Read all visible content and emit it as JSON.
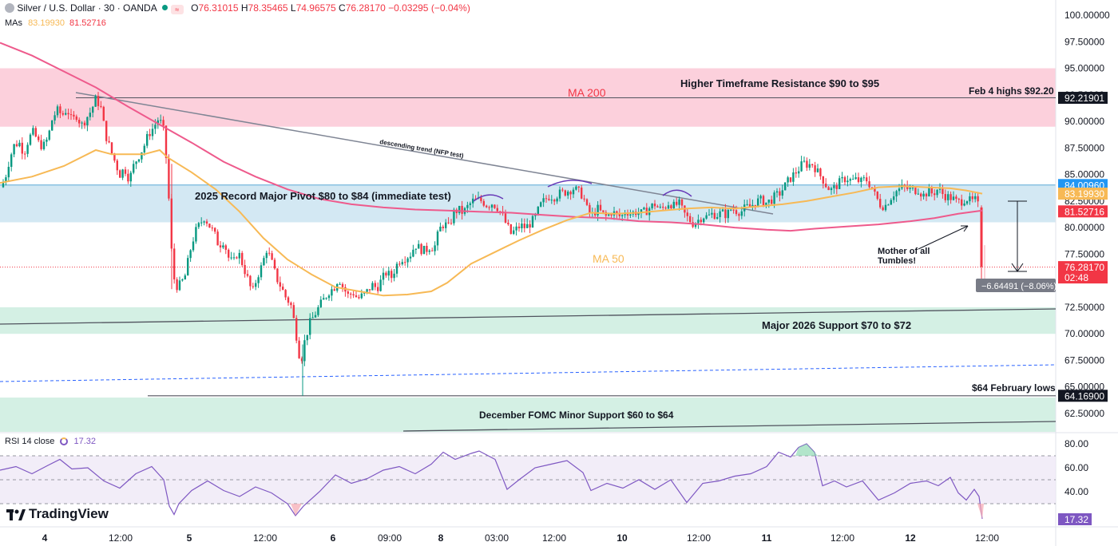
{
  "header": {
    "symbol": "Silver / U.S. Dollar · 30 · OANDA",
    "ohlc": {
      "o_label": "O",
      "o": "76.31015",
      "h_label": "H",
      "h": "78.35465",
      "l_label": "L",
      "l": "74.96575",
      "c_label": "C",
      "c": "76.28170",
      "change": "−0.03295 (−0.04%)"
    },
    "mas_label": "MAs",
    "ma50_value": "83.19930",
    "ma200_value": "81.52716",
    "rsi_label": "RSI 14 close",
    "rsi_value": "17.32"
  },
  "branding": {
    "logo_text": "TradingView"
  },
  "colors": {
    "bull": "#089981",
    "bear": "#f23645",
    "ma50": "#f7b955",
    "ma200": "#ee5a8c",
    "rsi": "#7e57c2",
    "axis_text": "#131722"
  },
  "chart_data": {
    "type": "candlestick",
    "symbol": "Silver / U.S. Dollar",
    "timeframe": "30",
    "price_axis": {
      "ticks": [
        "100.00000",
        "97.50000",
        "95.00000",
        "92.50000",
        "90.00000",
        "87.50000",
        "85.00000",
        "82.50000",
        "80.00000",
        "77.50000",
        "72.50000",
        "70.00000",
        "67.50000",
        "65.00000",
        "62.50000"
      ],
      "ylim": [
        60.2,
        100.8
      ]
    },
    "time_axis": {
      "labels": [
        "4",
        "12:00",
        "5",
        "12:00",
        "6",
        "09:00",
        "8",
        "03:00",
        "12:00",
        "10",
        "12:00",
        "11",
        "12:00",
        "12",
        "12:00"
      ],
      "bold_labels": [
        "4",
        "5",
        "6",
        "8",
        "10",
        "11",
        "12"
      ]
    },
    "price_labels": [
      {
        "text": "92.21901",
        "price": 92.219,
        "color": "#131722"
      },
      {
        "text": "84.00960",
        "price": 84.0096,
        "color": "#2196f3"
      },
      {
        "text": "83.19930",
        "price": 83.1993,
        "color": "#f7b955"
      },
      {
        "text": "81.52716",
        "price": 81.52716,
        "color": "#f23645"
      },
      {
        "text": "76.28170",
        "price": 76.2817,
        "color": "#f23645",
        "sub": "02:48"
      },
      {
        "text": "64.16900",
        "price": 64.169,
        "color": "#131722"
      }
    ],
    "zones": [
      {
        "label": "Higher Timeframe Resistance $90 to $95",
        "from": 89.5,
        "to": 95.0,
        "color": "#fcd0dc"
      },
      {
        "label": "2025 Record Major Pivot $80 to $84 (immediate test)",
        "from": 80.5,
        "to": 84.0,
        "color": "#d3e8f3"
      },
      {
        "label": "Major 2026 Support $70 to $72",
        "from": 70.0,
        "to": 72.5,
        "color": "#d4f0e4"
      },
      {
        "label": "December FOMC Minor Support $60 to $64",
        "from": 60.3,
        "to": 64.0,
        "color": "#d4f0e4"
      }
    ],
    "annotations": [
      {
        "text": "MA 200",
        "color": "#f23645"
      },
      {
        "text": "MA 50",
        "color": "#f7b955"
      },
      {
        "text": "Feb 4 highs $92.20"
      },
      {
        "text": "descending trend (NFP test)"
      },
      {
        "text": "$64 February lows"
      },
      {
        "text": "Mother of all"
      },
      {
        "text": "Tumbles!"
      },
      {
        "text": "−6.64491 (−8.06%)"
      }
    ],
    "close_points": [
      [
        0,
        83.8
      ],
      [
        6,
        84.5
      ],
      [
        12,
        86.5
      ],
      [
        18,
        87.8
      ],
      [
        24,
        88.0
      ],
      [
        30,
        87.0
      ],
      [
        36,
        88.4
      ],
      [
        42,
        89.0
      ],
      [
        48,
        88.0
      ],
      [
        54,
        87.6
      ],
      [
        60,
        88.4
      ],
      [
        66,
        90.4
      ],
      [
        72,
        91.0
      ],
      [
        78,
        90.6
      ],
      [
        84,
        91.2
      ],
      [
        90,
        90.0
      ],
      [
        96,
        90.6
      ],
      [
        102,
        89.6
      ],
      [
        108,
        90.3
      ],
      [
        114,
        91.0
      ],
      [
        120,
        92.1
      ],
      [
        126,
        91.4
      ],
      [
        132,
        88.8
      ],
      [
        138,
        87.4
      ],
      [
        144,
        86.2
      ],
      [
        150,
        85.0
      ],
      [
        156,
        85.6
      ],
      [
        162,
        84.5
      ],
      [
        168,
        86.0
      ],
      [
        174,
        86.8
      ],
      [
        180,
        87.6
      ],
      [
        186,
        88.8
      ],
      [
        192,
        89.4
      ],
      [
        198,
        90.2
      ],
      [
        204,
        89.6
      ],
      [
        208,
        86.6
      ],
      [
        212,
        82.0
      ],
      [
        216,
        76.0
      ],
      [
        220,
        74.5
      ],
      [
        226,
        74.6
      ],
      [
        232,
        75.5
      ],
      [
        238,
        77.8
      ],
      [
        244,
        79.5
      ],
      [
        250,
        80.3
      ],
      [
        256,
        81.0
      ],
      [
        262,
        80.2
      ],
      [
        268,
        79.5
      ],
      [
        274,
        78.3
      ],
      [
        280,
        78.8
      ],
      [
        286,
        77.2
      ],
      [
        292,
        76.6
      ],
      [
        298,
        77.8
      ],
      [
        304,
        76.5
      ],
      [
        310,
        75.2
      ],
      [
        316,
        73.8
      ],
      [
        322,
        75.4
      ],
      [
        328,
        76.4
      ],
      [
        334,
        78.0
      ],
      [
        340,
        76.8
      ],
      [
        346,
        75.3
      ],
      [
        352,
        74.4
      ],
      [
        358,
        73.4
      ],
      [
        364,
        72.8
      ],
      [
        370,
        70.5
      ],
      [
        374,
        68.2
      ],
      [
        378,
        67.8
      ],
      [
        382,
        69.5
      ],
      [
        388,
        71.0
      ],
      [
        394,
        71.8
      ],
      [
        400,
        72.6
      ],
      [
        406,
        73.3
      ],
      [
        412,
        74.0
      ],
      [
        418,
        74.3
      ],
      [
        424,
        75.3
      ],
      [
        430,
        74.3
      ],
      [
        436,
        73.6
      ],
      [
        442,
        73.9
      ],
      [
        448,
        73.3
      ],
      [
        454,
        73.6
      ],
      [
        460,
        74.0
      ],
      [
        466,
        74.6
      ],
      [
        472,
        74.3
      ],
      [
        478,
        75.1
      ],
      [
        484,
        75.8
      ],
      [
        490,
        75.3
      ],
      [
        496,
        76.4
      ],
      [
        502,
        77.1
      ],
      [
        508,
        77.2
      ],
      [
        514,
        77.5
      ],
      [
        520,
        78.4
      ],
      [
        526,
        78.0
      ],
      [
        532,
        77.8
      ],
      [
        538,
        78.2
      ],
      [
        544,
        78.1
      ],
      [
        550,
        79.8
      ],
      [
        556,
        80.4
      ],
      [
        562,
        80.0
      ],
      [
        568,
        81.4
      ],
      [
        574,
        81.7
      ],
      [
        580,
        81.4
      ],
      [
        586,
        82.0
      ],
      [
        592,
        82.5
      ],
      [
        598,
        82.6
      ],
      [
        604,
        82.5
      ],
      [
        610,
        82.1
      ],
      [
        616,
        82.3
      ],
      [
        622,
        82.0
      ],
      [
        628,
        81.3
      ],
      [
        634,
        80.3
      ],
      [
        640,
        79.4
      ],
      [
        646,
        79.8
      ],
      [
        652,
        80.2
      ],
      [
        658,
        80.0
      ],
      [
        664,
        80.4
      ],
      [
        670,
        80.9
      ],
      [
        676,
        82.0
      ],
      [
        682,
        82.6
      ],
      [
        688,
        83.0
      ],
      [
        694,
        82.9
      ],
      [
        700,
        83.2
      ],
      [
        706,
        83.3
      ],
      [
        712,
        83.5
      ],
      [
        718,
        83.7
      ],
      [
        724,
        83.4
      ],
      [
        730,
        83.0
      ],
      [
        736,
        81.5
      ],
      [
        742,
        81.2
      ],
      [
        748,
        81.8
      ],
      [
        754,
        81.3
      ],
      [
        760,
        81.0
      ],
      [
        766,
        81.5
      ],
      [
        772,
        81.2
      ],
      [
        778,
        81.0
      ],
      [
        784,
        81.6
      ],
      [
        790,
        81.3
      ],
      [
        796,
        81.5
      ],
      [
        802,
        81.3
      ],
      [
        808,
        81.5
      ],
      [
        814,
        81.9
      ],
      [
        820,
        82.2
      ],
      [
        826,
        81.7
      ],
      [
        832,
        81.9
      ],
      [
        838,
        82.4
      ],
      [
        844,
        82.0
      ],
      [
        850,
        82.3
      ],
      [
        856,
        81.4
      ],
      [
        862,
        80.8
      ],
      [
        868,
        80.4
      ],
      [
        874,
        80.7
      ],
      [
        880,
        81.1
      ],
      [
        886,
        81.0
      ],
      [
        892,
        81.3
      ],
      [
        898,
        81.2
      ],
      [
        904,
        81.4
      ],
      [
        910,
        81.2
      ],
      [
        916,
        81.8
      ],
      [
        922,
        81.6
      ],
      [
        928,
        81.5
      ],
      [
        934,
        81.9
      ],
      [
        940,
        82.0
      ],
      [
        946,
        82.4
      ],
      [
        952,
        82.6
      ],
      [
        958,
        82.3
      ],
      [
        964,
        82.5
      ],
      [
        970,
        82.9
      ],
      [
        976,
        83.2
      ],
      [
        982,
        83.8
      ],
      [
        988,
        84.5
      ],
      [
        994,
        85.0
      ],
      [
        1000,
        85.5
      ],
      [
        1006,
        86.1
      ],
      [
        1012,
        85.9
      ],
      [
        1018,
        86.0
      ],
      [
        1024,
        85.2
      ],
      [
        1030,
        84.6
      ],
      [
        1036,
        83.8
      ],
      [
        1042,
        83.5
      ],
      [
        1048,
        84.0
      ],
      [
        1054,
        84.4
      ],
      [
        1060,
        84.7
      ],
      [
        1066,
        84.4
      ],
      [
        1072,
        84.5
      ],
      [
        1078,
        84.3
      ],
      [
        1084,
        84.6
      ],
      [
        1090,
        84.0
      ],
      [
        1096,
        83.0
      ],
      [
        1102,
        82.2
      ],
      [
        1108,
        82.0
      ],
      [
        1114,
        82.7
      ],
      [
        1120,
        83.3
      ],
      [
        1126,
        83.6
      ],
      [
        1132,
        83.8
      ],
      [
        1138,
        83.6
      ],
      [
        1144,
        83.5
      ],
      [
        1150,
        83.6
      ],
      [
        1156,
        83.0
      ],
      [
        1162,
        83.4
      ],
      [
        1168,
        83.2
      ],
      [
        1174,
        83.6
      ],
      [
        1180,
        83.2
      ],
      [
        1186,
        82.9
      ],
      [
        1192,
        82.8
      ],
      [
        1198,
        82.4
      ],
      [
        1204,
        82.5
      ],
      [
        1210,
        82.8
      ],
      [
        1216,
        82.4
      ],
      [
        1222,
        82.6
      ],
      [
        1226,
        81.8
      ],
      [
        1230,
        76.3
      ]
    ],
    "ma50_points": [
      [
        0,
        84.2
      ],
      [
        40,
        84.8
      ],
      [
        80,
        85.8
      ],
      [
        120,
        87.3
      ],
      [
        140,
        86.9
      ],
      [
        180,
        86.9
      ],
      [
        200,
        87.3
      ],
      [
        210,
        86.6
      ],
      [
        240,
        85.2
      ],
      [
        270,
        83.6
      ],
      [
        300,
        81.5
      ],
      [
        330,
        79.0
      ],
      [
        360,
        77.0
      ],
      [
        390,
        75.6
      ],
      [
        420,
        74.4
      ],
      [
        450,
        74.0
      ],
      [
        480,
        73.6
      ],
      [
        510,
        73.7
      ],
      [
        540,
        74.0
      ],
      [
        560,
        74.8
      ],
      [
        590,
        76.6
      ],
      [
        620,
        77.7
      ],
      [
        650,
        78.8
      ],
      [
        680,
        79.8
      ],
      [
        710,
        80.7
      ],
      [
        740,
        81.4
      ],
      [
        770,
        81.3
      ],
      [
        800,
        81.4
      ],
      [
        830,
        81.6
      ],
      [
        860,
        81.8
      ],
      [
        890,
        81.9
      ],
      [
        920,
        81.8
      ],
      [
        950,
        82.0
      ],
      [
        980,
        82.2
      ],
      [
        1010,
        82.5
      ],
      [
        1040,
        82.9
      ],
      [
        1070,
        83.3
      ],
      [
        1100,
        83.8
      ],
      [
        1130,
        83.9
      ],
      [
        1160,
        83.8
      ],
      [
        1190,
        83.7
      ],
      [
        1210,
        83.5
      ],
      [
        1230,
        83.2
      ]
    ],
    "ma200_points": [
      [
        0,
        97.4
      ],
      [
        40,
        96.2
      ],
      [
        80,
        94.7
      ],
      [
        120,
        93.2
      ],
      [
        160,
        91.4
      ],
      [
        200,
        89.7
      ],
      [
        240,
        88.0
      ],
      [
        280,
        86.2
      ],
      [
        320,
        84.8
      ],
      [
        360,
        83.6
      ],
      [
        400,
        82.7
      ],
      [
        440,
        82.2
      ],
      [
        480,
        81.9
      ],
      [
        520,
        81.7
      ],
      [
        560,
        81.6
      ],
      [
        600,
        81.5
      ],
      [
        640,
        81.4
      ],
      [
        680,
        81.2
      ],
      [
        720,
        81.0
      ],
      [
        760,
        80.9
      ],
      [
        800,
        80.6
      ],
      [
        840,
        80.5
      ],
      [
        880,
        80.3
      ],
      [
        920,
        80.0
      ],
      [
        960,
        79.8
      ],
      [
        990,
        79.7
      ],
      [
        1020,
        79.9
      ],
      [
        1060,
        80.1
      ],
      [
        1100,
        80.3
      ],
      [
        1140,
        80.6
      ],
      [
        1170,
        80.9
      ],
      [
        1200,
        81.3
      ],
      [
        1230,
        81.6
      ]
    ],
    "rsi": {
      "label": "RSI 14 close",
      "value": 17.32,
      "ticks": [
        "80.00",
        "60.00",
        "40.00"
      ],
      "band": [
        30,
        70
      ],
      "points": [
        [
          0,
          58
        ],
        [
          20,
          61
        ],
        [
          40,
          55
        ],
        [
          60,
          62
        ],
        [
          75,
          67
        ],
        [
          90,
          59
        ],
        [
          110,
          60
        ],
        [
          130,
          49
        ],
        [
          150,
          43
        ],
        [
          170,
          55
        ],
        [
          190,
          61
        ],
        [
          205,
          50
        ],
        [
          212,
          28
        ],
        [
          218,
          21
        ],
        [
          224,
          30
        ],
        [
          240,
          41
        ],
        [
          260,
          49
        ],
        [
          280,
          41
        ],
        [
          300,
          36
        ],
        [
          320,
          44
        ],
        [
          340,
          39
        ],
        [
          360,
          30
        ],
        [
          370,
          20
        ],
        [
          380,
          28
        ],
        [
          400,
          40
        ],
        [
          420,
          54
        ],
        [
          440,
          47
        ],
        [
          460,
          51
        ],
        [
          480,
          58
        ],
        [
          500,
          61
        ],
        [
          520,
          55
        ],
        [
          540,
          63
        ],
        [
          555,
          73
        ],
        [
          570,
          67
        ],
        [
          590,
          72
        ],
        [
          600,
          74
        ],
        [
          620,
          67
        ],
        [
          635,
          42
        ],
        [
          650,
          50
        ],
        [
          670,
          60
        ],
        [
          690,
          63
        ],
        [
          710,
          66
        ],
        [
          730,
          56
        ],
        [
          740,
          41
        ],
        [
          760,
          47
        ],
        [
          780,
          43
        ],
        [
          800,
          50
        ],
        [
          820,
          42
        ],
        [
          840,
          50
        ],
        [
          860,
          31
        ],
        [
          880,
          47
        ],
        [
          900,
          49
        ],
        [
          920,
          53
        ],
        [
          940,
          55
        ],
        [
          960,
          61
        ],
        [
          975,
          73
        ],
        [
          990,
          69
        ],
        [
          1000,
          77
        ],
        [
          1010,
          80
        ],
        [
          1020,
          73
        ],
        [
          1030,
          45
        ],
        [
          1045,
          49
        ],
        [
          1060,
          44
        ],
        [
          1080,
          49
        ],
        [
          1100,
          33
        ],
        [
          1120,
          39
        ],
        [
          1140,
          47
        ],
        [
          1160,
          49
        ],
        [
          1175,
          45
        ],
        [
          1190,
          52
        ],
        [
          1200,
          39
        ],
        [
          1210,
          33
        ],
        [
          1220,
          42
        ],
        [
          1226,
          36
        ],
        [
          1230,
          17.3
        ]
      ]
    }
  }
}
